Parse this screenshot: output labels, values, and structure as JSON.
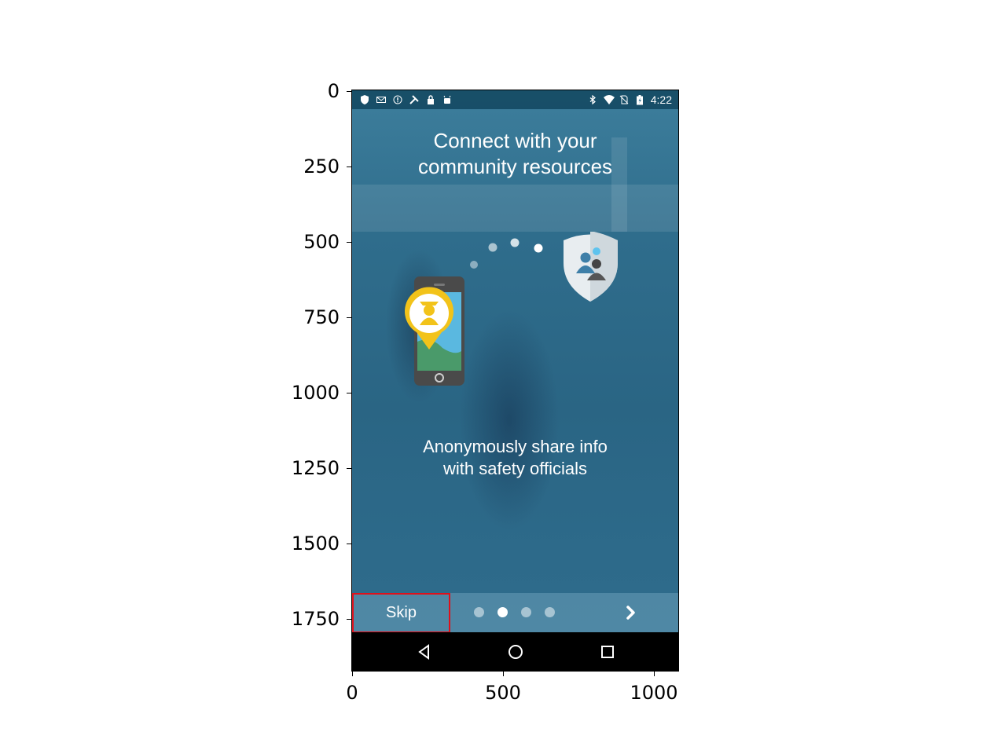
{
  "status_bar": {
    "left_icons": [
      "shield-icon",
      "mail-icon",
      "alert-icon",
      "tools-icon",
      "lock-icon",
      "android-icon"
    ],
    "right_icons": [
      "bluetooth-icon",
      "wifi-icon",
      "no-sim-icon",
      "battery-charging-icon"
    ],
    "time": "4:22"
  },
  "onboarding": {
    "title_line1": "Connect with your",
    "title_line2": "community resources",
    "subtitle_line1": "Anonymously share info",
    "subtitle_line2": "with safety officials"
  },
  "bottom_bar": {
    "skip_label": "Skip",
    "page_count": 4,
    "active_page": 2,
    "next_icon": "chevron-right-icon"
  },
  "nav_bar": {
    "buttons": [
      "back-icon",
      "home-icon",
      "recents-icon"
    ]
  },
  "axes": {
    "y_ticks": [
      "0",
      "250",
      "500",
      "750",
      "1000",
      "1250",
      "1500",
      "1750"
    ],
    "x_ticks": [
      "0",
      "500",
      "1000"
    ]
  },
  "colors": {
    "accent_yellow": "#f2c31a",
    "shield": "#e8edf0",
    "overlay_blue": "#2f6d8c",
    "skip_highlight": "#e0101a"
  }
}
